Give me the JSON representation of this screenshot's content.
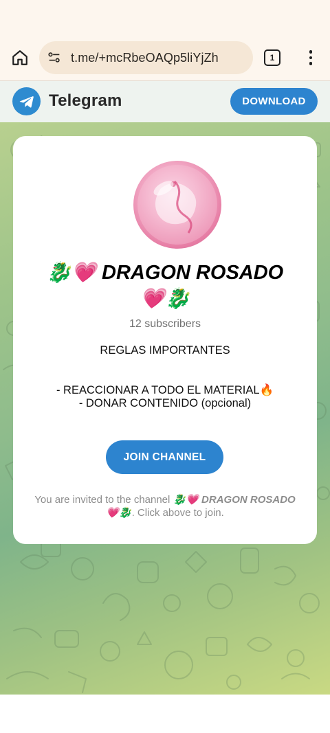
{
  "browser": {
    "url": "t.me/+mcRbeOAQp5liYjZh",
    "tab_count": "1",
    "icons": {
      "home": "home-icon",
      "site_info": "site-settings-icon",
      "menu": "more-vert-icon"
    }
  },
  "header": {
    "app_name": "Telegram",
    "download_label": "DOWNLOAD",
    "logo_icon": "telegram-plane-icon"
  },
  "channel": {
    "name_line1": "🐉💗 DRAGON ROSADO",
    "name_line2": "💗🐉",
    "subscribers": "12 subscribers",
    "description": [
      "REGLAS IMPORTANTES",
      "- REACCIONAR A TODO EL MATERIAL🔥",
      "- DONAR CONTENIDO (opcional)"
    ],
    "join_label": "JOIN CHANNEL",
    "invite_prefix": "You are invited to the channel ",
    "invite_name": "🐉💗 DRAGON ROSADO 💗🐉",
    "invite_suffix": ". Click above to join."
  },
  "colors": {
    "accent": "#2d84cf",
    "browser_bg": "#fdf6ee",
    "url_pill": "#f5e7d6",
    "header_bg": "#eef3ef"
  }
}
